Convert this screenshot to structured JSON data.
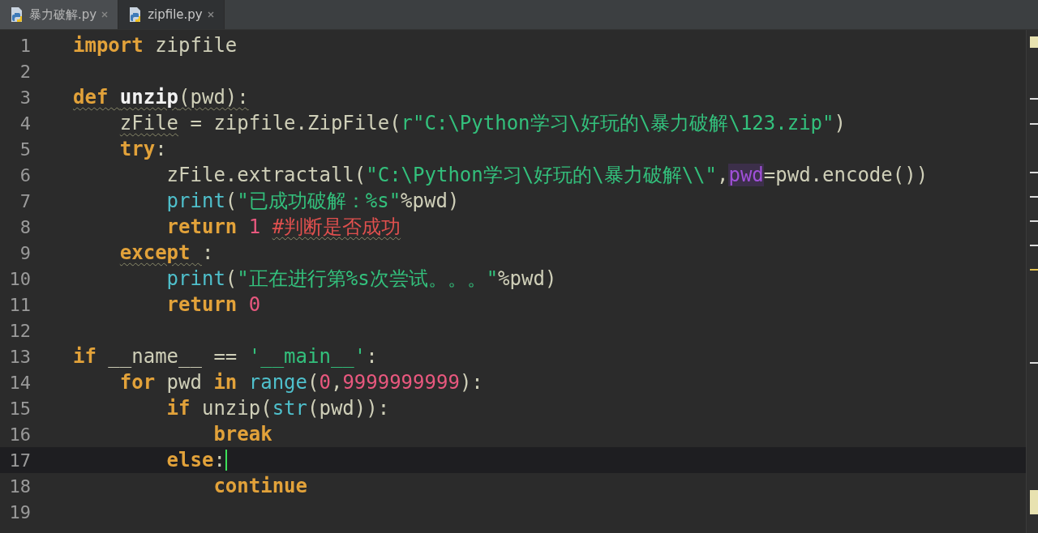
{
  "tabs": [
    {
      "label": "暴力破解.py",
      "selected": false
    },
    {
      "label": "zipfile.py",
      "selected": true
    }
  ],
  "lines": [
    {
      "number": "1",
      "current": false,
      "tokens": [
        {
          "kind": "keyword",
          "text": "import"
        },
        {
          "kind": "plain",
          "text": " zipfile"
        }
      ]
    },
    {
      "number": "2",
      "current": false
    },
    {
      "number": "3",
      "current": false,
      "tokens": [
        {
          "kind": "keyword",
          "text": "def ",
          "warning": true
        },
        {
          "kind": "function",
          "text": "unzip",
          "warning": true
        },
        {
          "kind": "plain",
          "text": "(pwd):",
          "warning": true
        }
      ]
    },
    {
      "number": "4",
      "current": false,
      "tokens": [
        {
          "kind": "plain",
          "text": "    zFile",
          "warning": true
        },
        {
          "kind": "plain",
          "text": " = zipfile.ZipFile("
        },
        {
          "kind": "string",
          "text": "r\"C:\\Python学习\\好玩的\\暴力破解\\123.zip\""
        },
        {
          "kind": "plain",
          "text": ")"
        }
      ]
    },
    {
      "number": "5",
      "current": false,
      "tokens": [
        {
          "kind": "keyword",
          "text": "    try"
        },
        {
          "kind": "plain",
          "text": ":"
        }
      ]
    },
    {
      "number": "6",
      "current": false,
      "tokens": [
        {
          "kind": "plain",
          "text": "        zFile.extractall("
        },
        {
          "kind": "string",
          "text": "\"C:\\Python学习\\好玩的\\暴力破解\\\\\""
        },
        {
          "kind": "plain",
          "text": ","
        },
        {
          "kind": "param",
          "text": "pwd"
        },
        {
          "kind": "plain",
          "text": "=pwd.encode())"
        }
      ]
    },
    {
      "number": "7",
      "current": false,
      "tokens": [
        {
          "kind": "builtin",
          "text": "        print"
        },
        {
          "kind": "plain",
          "text": "("
        },
        {
          "kind": "string",
          "text": "\"已成功破解：%s\""
        },
        {
          "kind": "plain",
          "text": "%pwd)"
        }
      ]
    },
    {
      "number": "8",
      "current": false,
      "tokens": [
        {
          "kind": "keyword",
          "text": "        return"
        },
        {
          "kind": "number",
          "text": " 1"
        },
        {
          "kind": "comment",
          "text": " #判断是否成功",
          "warning": true
        }
      ]
    },
    {
      "number": "9",
      "current": false,
      "tokens": [
        {
          "kind": "keyword",
          "text": "    except ",
          "warning": true
        },
        {
          "kind": "plain",
          "text": ":"
        }
      ]
    },
    {
      "number": "10",
      "current": false,
      "tokens": [
        {
          "kind": "builtin",
          "text": "        print"
        },
        {
          "kind": "plain",
          "text": "("
        },
        {
          "kind": "string",
          "text": "\"正在进行第%s次尝试。。。\""
        },
        {
          "kind": "plain",
          "text": "%pwd)"
        }
      ]
    },
    {
      "number": "11",
      "current": false,
      "tokens": [
        {
          "kind": "keyword",
          "text": "        return"
        },
        {
          "kind": "number",
          "text": " 0"
        }
      ]
    },
    {
      "number": "12",
      "current": false
    },
    {
      "number": "13",
      "current": false,
      "tokens": [
        {
          "kind": "keyword",
          "text": "if"
        },
        {
          "kind": "plain",
          "text": " __name__ == "
        },
        {
          "kind": "string",
          "text": "'__main__'"
        },
        {
          "kind": "plain",
          "text": ":"
        }
      ]
    },
    {
      "number": "14",
      "current": false,
      "tokens": [
        {
          "kind": "keyword",
          "text": "    for"
        },
        {
          "kind": "plain",
          "text": " pwd "
        },
        {
          "kind": "keyword",
          "text": "in"
        },
        {
          "kind": "builtin",
          "text": " range"
        },
        {
          "kind": "plain",
          "text": "("
        },
        {
          "kind": "number",
          "text": "0"
        },
        {
          "kind": "plain",
          "text": ","
        },
        {
          "kind": "number",
          "text": "9999999999"
        },
        {
          "kind": "plain",
          "text": "):"
        }
      ]
    },
    {
      "number": "15",
      "current": false,
      "tokens": [
        {
          "kind": "keyword",
          "text": "        if"
        },
        {
          "kind": "plain",
          "text": " unzip("
        },
        {
          "kind": "builtin",
          "text": "str"
        },
        {
          "kind": "plain",
          "text": "(pwd)):"
        }
      ]
    },
    {
      "number": "16",
      "current": false,
      "tokens": [
        {
          "kind": "keyword",
          "text": "            break"
        }
      ]
    },
    {
      "number": "17",
      "current": true,
      "tokens": [
        {
          "kind": "keyword",
          "text": "        else"
        },
        {
          "kind": "plain",
          "text": ":"
        }
      ]
    },
    {
      "number": "18",
      "current": false,
      "tokens": [
        {
          "kind": "keyword",
          "text": "            continue"
        }
      ]
    },
    {
      "number": "19",
      "current": false
    }
  ]
}
